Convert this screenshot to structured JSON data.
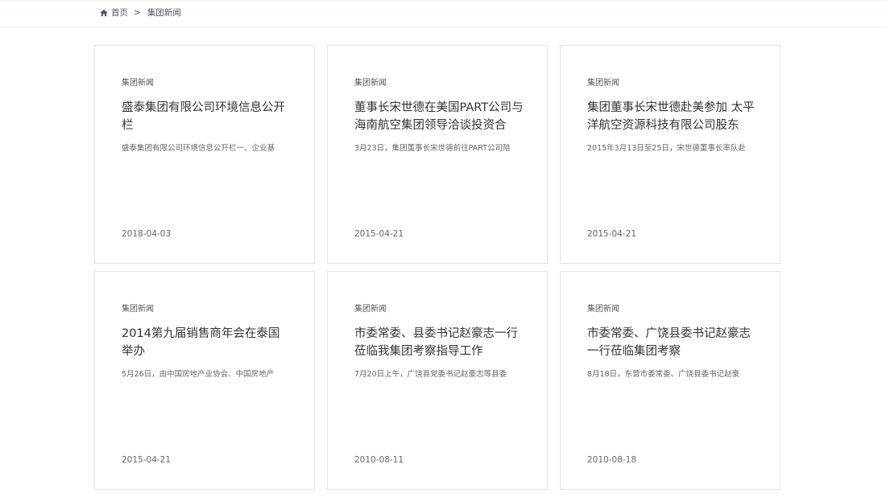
{
  "breadcrumb": {
    "home_label": "首页",
    "separator": ">",
    "current_label": "集团新闻"
  },
  "cards": [
    {
      "category": "集团新闻",
      "title": "盛泰集团有限公司环境信息公开栏",
      "excerpt": "盛泰集团有限公司环境信息公开栏一、企业基",
      "date": "2018-04-03"
    },
    {
      "category": "集团新闻",
      "title": "董事长宋世德在美国PART公司与海南航空集团领导洽谈投资合",
      "excerpt": "3月23日，集团董事长宋世德前往PART公司陪",
      "date": "2015-04-21"
    },
    {
      "category": "集团新闻",
      "title": "集团董事长宋世德赴美参加 太平洋航空资源科技有限公司股东",
      "excerpt": "2015年3月13日至25日，宋世德董事长率队赴",
      "date": "2015-04-21"
    },
    {
      "category": "集团新闻",
      "title": "2014第九届销售商年会在泰国举办",
      "excerpt": "5月26日，由中国房地产业协会、中国房地产",
      "date": "2015-04-21"
    },
    {
      "category": "集团新闻",
      "title": "市委常委、县委书记赵豪志一行莅临我集团考察指导工作",
      "excerpt": "7月20日上午，广饶县党委书记赵豪志等县委",
      "date": "2010-08-11"
    },
    {
      "category": "集团新闻",
      "title": "市委常委、广饶县委书记赵豪志一行莅临集团考察",
      "excerpt": "8月18日，东营市委常委、广饶县委书记赵豪",
      "date": "2010-08-18"
    }
  ]
}
